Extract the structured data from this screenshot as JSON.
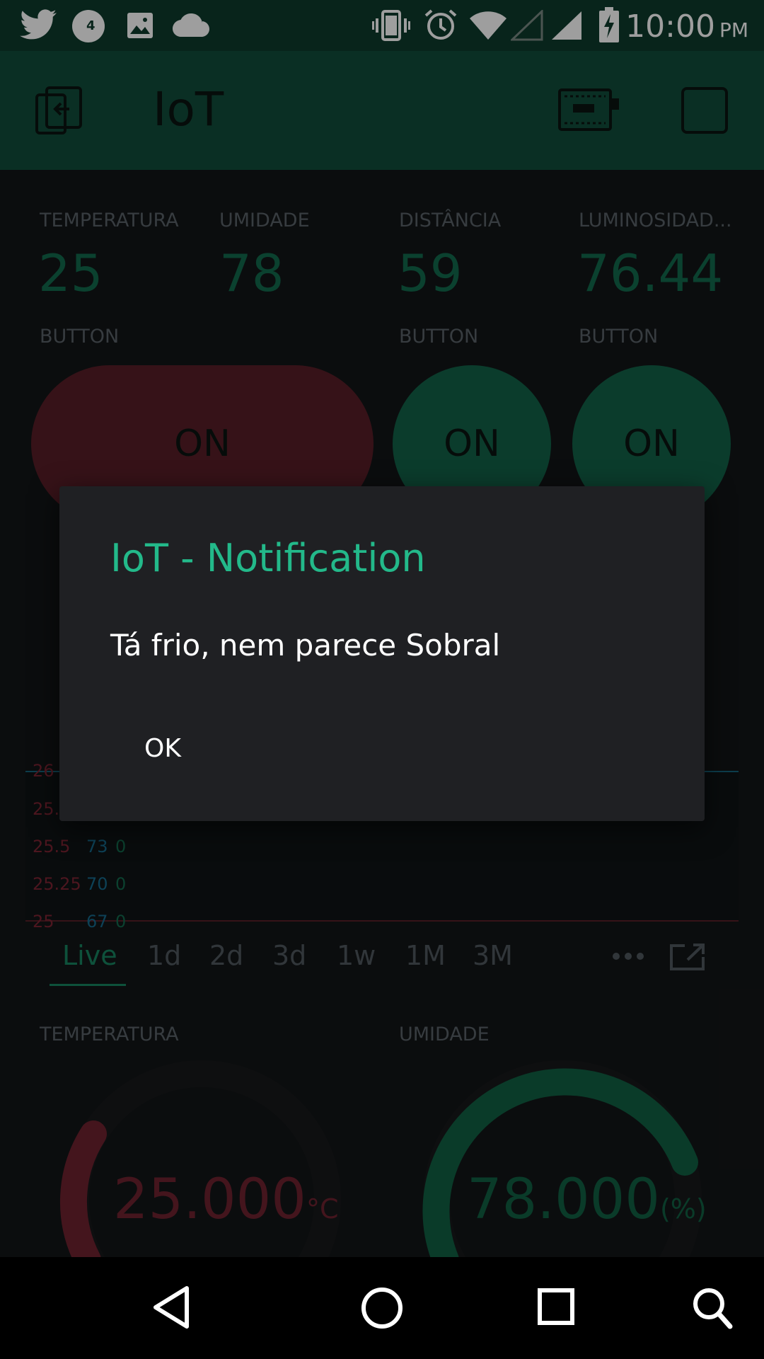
{
  "status_bar": {
    "time": "10:00",
    "ampm": "PM",
    "notification_badge": "4",
    "icons": [
      "twitter-icon",
      "notification-badge-icon",
      "gallery-icon",
      "cloud-icon",
      "vibrate-icon",
      "alarm-icon",
      "wifi-icon",
      "signal-empty-icon",
      "signal-icon",
      "battery-charging-icon"
    ]
  },
  "app_bar": {
    "title": "IoT",
    "icons": [
      "exit-icon",
      "device-icon",
      "square-icon"
    ]
  },
  "values": [
    {
      "label": "TEMPERATURA",
      "value": "25"
    },
    {
      "label": "UMIDADE",
      "value": "78"
    },
    {
      "label": "DISTÂNCIA",
      "value": "59"
    },
    {
      "label": "LUMINOSIDAD...",
      "value": "76.44"
    }
  ],
  "buttons": [
    {
      "label": "BUTTON",
      "state": "ON",
      "color": "#581e27"
    },
    {
      "label": "BUTTON",
      "state": "ON",
      "color": "#126148"
    },
    {
      "label": "BUTTON",
      "state": "ON",
      "color": "#126148"
    }
  ],
  "chart": {
    "left_ticks": [
      "26",
      "25.",
      "25.5",
      "25.25",
      "25"
    ],
    "mid_ticks": [
      "73",
      "70",
      "67"
    ],
    "right_ticks": [
      "0",
      "0",
      "0"
    ],
    "colors": {
      "red": "#9a2637",
      "blue": "#166a8c",
      "green": "#136a4d"
    }
  },
  "tabs": [
    "Live",
    "1d",
    "2d",
    "3d",
    "1w",
    "1M",
    "3M"
  ],
  "active_tab": "Live",
  "gauges": [
    {
      "label": "TEMPERATURA",
      "value": "25.000",
      "unit": "°C",
      "color": "#6e2230"
    },
    {
      "label": "UMIDADE",
      "value": "78.000",
      "unit": "(%)",
      "color": "#116043"
    }
  ],
  "dialog": {
    "title": "IoT - Notification",
    "message": "Tá frio, nem parece Sobral",
    "ok_label": "OK"
  },
  "nav_bar": {
    "icons": [
      "back-icon",
      "home-icon",
      "recents-icon",
      "search-icon"
    ]
  }
}
